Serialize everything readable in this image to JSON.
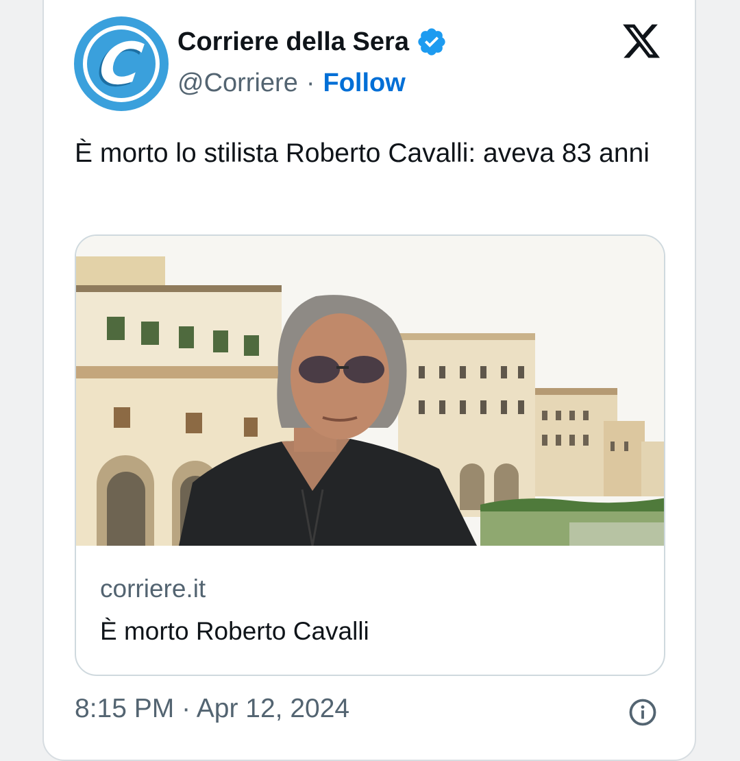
{
  "account": {
    "display_name": "Corriere della Sera",
    "handle": "@Corriere",
    "separator": "·",
    "follow_label": "Follow",
    "avatar_letter": "C",
    "verified_icon": "verified-badge-icon"
  },
  "tweet": {
    "text": "È morto lo stilista Roberto Cavalli: aveva 83 anni"
  },
  "link_card": {
    "domain": "corriere.it",
    "title": "È morto Roberto Cavalli"
  },
  "meta": {
    "timestamp": "8:15 PM · Apr 12, 2024",
    "info_icon": "info-icon"
  },
  "colors": {
    "brand_blue": "#3aa0dc",
    "follow_blue": "#006fd6",
    "verified_blue": "#1d9bf0",
    "secondary_text": "#536471"
  }
}
